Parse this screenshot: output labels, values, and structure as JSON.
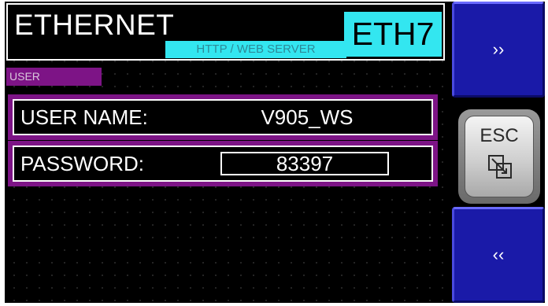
{
  "header": {
    "title": "ETHERNET",
    "subtitle": "HTTP / WEB SERVER",
    "code": "ETH7"
  },
  "section": {
    "badge": "USER"
  },
  "fields": {
    "username_label": "USER NAME:",
    "username_value": "V905_WS",
    "password_label": "PASSWORD:",
    "password_value": "83397"
  },
  "buttons": {
    "next_label": "››",
    "prev_label": "‹‹",
    "esc_label": "ESC"
  },
  "colors": {
    "cyan": "#33e6f0",
    "purple": "#7d1486",
    "nav_blue": "#1a1aa8",
    "background": "#000000"
  },
  "icons": {
    "esc_icon": "window-overlap-icon",
    "next_icon": "double-chevron-right-icon",
    "prev_icon": "double-chevron-left-icon"
  }
}
